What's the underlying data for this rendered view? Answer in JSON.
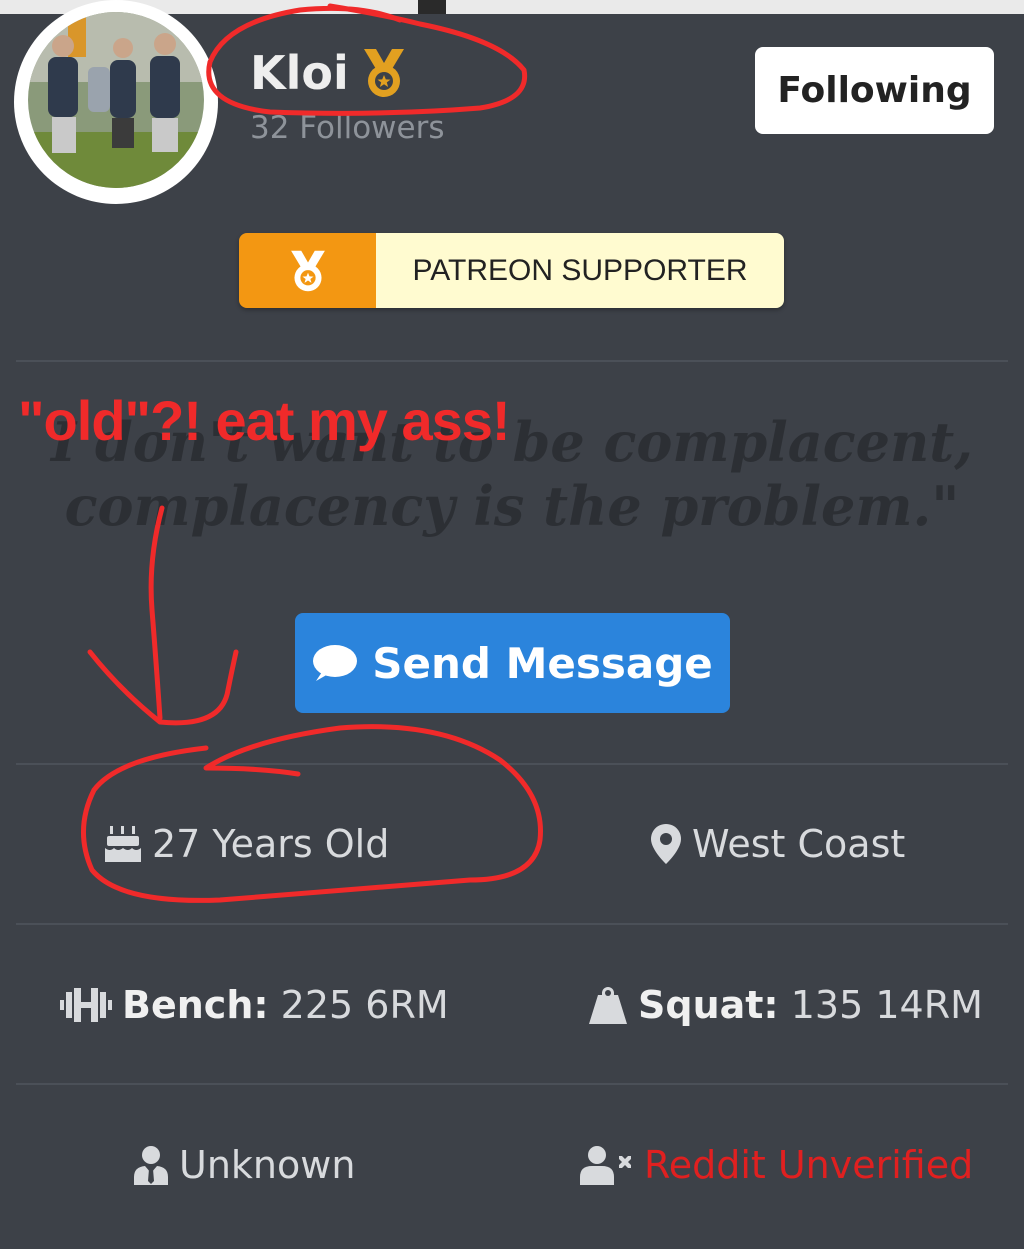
{
  "profile": {
    "username": "Kloi",
    "followers": "32 Followers",
    "follow_button": "Following"
  },
  "badge": {
    "label": "PATREON SUPPORTER",
    "icon": "medal-icon"
  },
  "quote": {
    "line1": "I don't want to be complacent,",
    "line2": "complacency is the problem.\""
  },
  "send_button": {
    "label": "Send Message",
    "icon": "chat-bubble-icon"
  },
  "details": {
    "age": "27 Years Old",
    "location": "West Coast",
    "bench_label": "Bench:",
    "bench_value": "225 6RM",
    "squat_label": "Squat:",
    "squat_value": "135 14RM",
    "occupation": "Unknown",
    "reddit_status": "Reddit Unverified"
  },
  "annotation": {
    "text": "\"old\"?! eat my ass!"
  },
  "colors": {
    "background": "#3d4148",
    "accent_blue": "#2b84dc",
    "patreon_orange": "#f39712",
    "patreon_label_bg": "#fffbd0",
    "unverified_red": "#e02020",
    "annotation_red": "#f02a2a"
  }
}
